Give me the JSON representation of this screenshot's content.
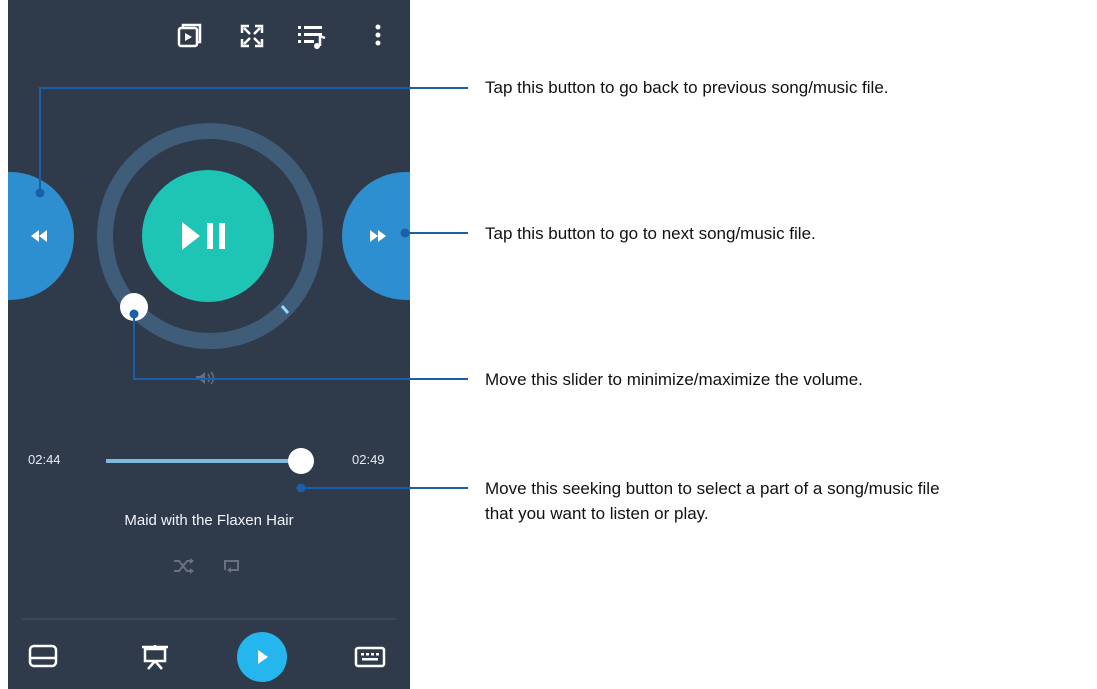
{
  "player": {
    "elapsed": "02:44",
    "duration": "02:49",
    "song_title": "Maid with the Flaxen Hair",
    "seek_progress": 0.97,
    "volume_level": 0.05
  },
  "callouts": {
    "previous": "Tap this button to go back to previous song/music file.",
    "next": "Tap this button to go to next song/music file.",
    "volume": "Move this slider to minimize/maximize the volume.",
    "seek_line1": "Move this seeking button to select a part of a song/music file",
    "seek_line2": "that you want to listen or play."
  },
  "colors": {
    "panel_bg": "#2f3a4b",
    "side_button": "#2e8fd0",
    "play_button": "#1ec5b5",
    "ring": "#3f5c78",
    "callout_line": "#1a5fa8",
    "bottom_play": "#25b6ee"
  },
  "icons": [
    "cast-icon",
    "fullscreen-icon",
    "playlist-icon",
    "more-icon",
    "shuffle-icon",
    "repeat-icon",
    "touchpad-icon",
    "presentation-icon",
    "play-icon",
    "keyboard-icon"
  ]
}
